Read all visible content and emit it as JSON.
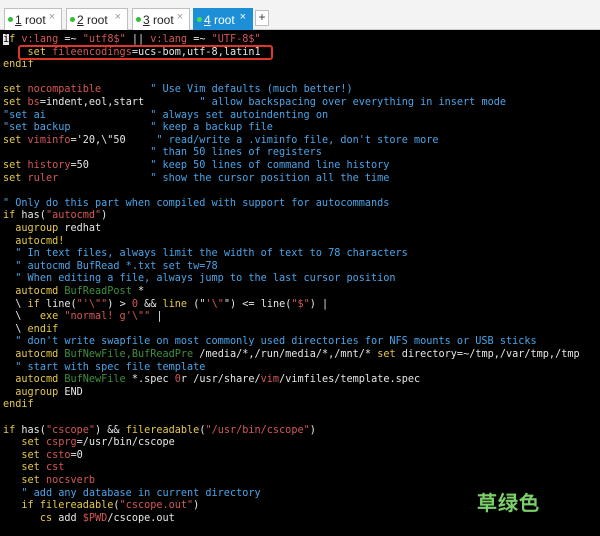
{
  "tabs": [
    {
      "num": "1",
      "label": "root",
      "close": "×"
    },
    {
      "num": "2",
      "label": "root",
      "close": "×"
    },
    {
      "num": "3",
      "label": "root",
      "close": "×"
    },
    {
      "num": "4",
      "label": "root",
      "close": "×"
    }
  ],
  "add_tab": "+",
  "lines": [
    [
      [
        "k",
        "i"
      ],
      [
        "k",
        "f "
      ],
      [
        "o",
        "v:lang"
      ],
      [
        "w",
        " =~ "
      ],
      [
        "o",
        "\"utf8$\""
      ],
      [
        "w",
        " || "
      ],
      [
        "o",
        "v:lang"
      ],
      [
        "w",
        " =~ "
      ],
      [
        "o",
        "\"UTF-8$\""
      ]
    ],
    [
      [
        "w",
        "    "
      ],
      [
        "k",
        "set "
      ],
      [
        "o",
        "fileencodings"
      ],
      [
        "w",
        "=ucs-bom,utf-8,latin1"
      ]
    ],
    [
      [
        "k",
        "endif"
      ]
    ],
    [],
    [
      [
        "k",
        "set "
      ],
      [
        "o",
        "nocompatible"
      ],
      [
        "w",
        "        "
      ],
      [
        "c",
        "\" Use Vim defaults (much better!)"
      ]
    ],
    [
      [
        "k",
        "set "
      ],
      [
        "o",
        "bs"
      ],
      [
        "w",
        "=indent,eol,start"
      ],
      [
        "w",
        "         "
      ],
      [
        "c",
        "\" allow backspacing over everything in insert mode"
      ]
    ],
    [
      [
        "c",
        "\"set ai"
      ],
      [
        "w",
        "                 "
      ],
      [
        "c",
        "\" always set autoindenting on"
      ]
    ],
    [
      [
        "c",
        "\"set backup"
      ],
      [
        "w",
        "             "
      ],
      [
        "c",
        "\" keep a backup file"
      ]
    ],
    [
      [
        "k",
        "set "
      ],
      [
        "o",
        "viminfo"
      ],
      [
        "w",
        "='20,\\\"50"
      ],
      [
        "w",
        "     "
      ],
      [
        "c",
        "\" read/write a .viminfo file, don't store more"
      ]
    ],
    [
      [
        "w",
        "                        "
      ],
      [
        "c",
        "\" than 50 lines of registers"
      ]
    ],
    [
      [
        "k",
        "set "
      ],
      [
        "o",
        "history"
      ],
      [
        "w",
        "=50"
      ],
      [
        "w",
        "          "
      ],
      [
        "c",
        "\" keep 50 lines of command line history"
      ]
    ],
    [
      [
        "k",
        "set "
      ],
      [
        "o",
        "ruler"
      ],
      [
        "w",
        "               "
      ],
      [
        "c",
        "\" show the cursor position all the time"
      ]
    ],
    [],
    [
      [
        "c",
        "\" Only do this part when compiled with support for autocommands"
      ]
    ],
    [
      [
        "k",
        "if "
      ],
      [
        "w",
        "has("
      ],
      [
        "o",
        "\"autocmd\""
      ],
      [
        "w",
        ")"
      ]
    ],
    [
      [
        "w",
        "  "
      ],
      [
        "k",
        "augroup"
      ],
      [
        "w",
        " redhat"
      ]
    ],
    [
      [
        "w",
        "  "
      ],
      [
        "k",
        "autocmd!"
      ]
    ],
    [
      [
        "w",
        "  "
      ],
      [
        "c",
        "\" In text files, always limit the width of text to 78 characters"
      ]
    ],
    [
      [
        "w",
        "  "
      ],
      [
        "c",
        "\" autocmd BufRead *.txt set tw=78"
      ]
    ],
    [
      [
        "w",
        "  "
      ],
      [
        "c",
        "\" When editing a file, always jump to the last cursor position"
      ]
    ],
    [
      [
        "w",
        "  "
      ],
      [
        "k",
        "autocmd "
      ],
      [
        "g",
        "BufReadPost"
      ],
      [
        "w",
        " *"
      ]
    ],
    [
      [
        "w",
        "  \\ "
      ],
      [
        "k",
        "if "
      ],
      [
        "w",
        "line("
      ],
      [
        "o",
        "\"'\\\"\""
      ],
      [
        "w",
        ") > "
      ],
      [
        "o",
        "0"
      ],
      [
        "w",
        " && "
      ],
      [
        "k",
        "line "
      ],
      [
        "w",
        "(\""
      ],
      [
        "o",
        "'\\\""
      ],
      [
        "w",
        "\") <= "
      ],
      [
        "w",
        "line("
      ],
      [
        "o",
        "\"$\""
      ],
      [
        "w",
        ") |"
      ]
    ],
    [
      [
        "w",
        "  \\   "
      ],
      [
        "k",
        "exe "
      ],
      [
        "o",
        "\"normal! g'\\\"\""
      ],
      [
        "w",
        " |"
      ]
    ],
    [
      [
        "w",
        "  \\ "
      ],
      [
        "k",
        "endif"
      ]
    ],
    [
      [
        "w",
        "  "
      ],
      [
        "c",
        "\" don't write swapfile on most commonly used directories for NFS mounts or USB sticks"
      ]
    ],
    [
      [
        "w",
        "  "
      ],
      [
        "k",
        "autocmd "
      ],
      [
        "g",
        "BufNewFile,BufReadPre"
      ],
      [
        "w",
        " /media/*,/run/media/*,/mnt/* "
      ],
      [
        "k",
        "set "
      ],
      [
        "w",
        "directory=~/tmp,/var/tmp,/tmp"
      ]
    ],
    [
      [
        "w",
        "  "
      ],
      [
        "c",
        "\" start with spec file template"
      ]
    ],
    [
      [
        "w",
        "  "
      ],
      [
        "k",
        "autocmd "
      ],
      [
        "g",
        "BufNewFile"
      ],
      [
        "w",
        " *.spec "
      ],
      [
        "o",
        "0"
      ],
      [
        "w",
        "r /usr/share/"
      ],
      [
        "o",
        "vim"
      ],
      [
        "w",
        "/vimfiles/template.spec"
      ]
    ],
    [
      [
        "w",
        "  "
      ],
      [
        "k",
        "augroup"
      ],
      [
        "w",
        " END"
      ]
    ],
    [
      [
        "k",
        "endif"
      ]
    ],
    [],
    [
      [
        "k",
        "if "
      ],
      [
        "w",
        "has("
      ],
      [
        "o",
        "\"cscope\""
      ],
      [
        "w",
        ") && "
      ],
      [
        "k",
        "filereadable"
      ],
      [
        "w",
        "("
      ],
      [
        "o",
        "\"/usr/bin/cscope\""
      ],
      [
        "w",
        ")"
      ]
    ],
    [
      [
        "w",
        "   "
      ],
      [
        "k",
        "set "
      ],
      [
        "o",
        "csprg"
      ],
      [
        "w",
        "=/usr/bin/cscope"
      ]
    ],
    [
      [
        "w",
        "   "
      ],
      [
        "k",
        "set "
      ],
      [
        "o",
        "csto"
      ],
      [
        "w",
        "=0"
      ]
    ],
    [
      [
        "w",
        "   "
      ],
      [
        "k",
        "set "
      ],
      [
        "o",
        "cst"
      ]
    ],
    [
      [
        "w",
        "   "
      ],
      [
        "k",
        "set "
      ],
      [
        "o",
        "nocsverb"
      ]
    ],
    [
      [
        "w",
        "   "
      ],
      [
        "c",
        "\" add any database in current directory"
      ]
    ],
    [
      [
        "w",
        "   "
      ],
      [
        "k",
        "if "
      ],
      [
        "k",
        "filereadable"
      ],
      [
        "w",
        "("
      ],
      [
        "o",
        "\"cscope.out\""
      ],
      [
        "w",
        ")"
      ]
    ],
    [
      [
        "w",
        "      "
      ],
      [
        "k",
        "cs "
      ],
      [
        "w",
        "add "
      ],
      [
        "o",
        "$PWD"
      ],
      [
        "w",
        "/cscope.out"
      ]
    ]
  ],
  "watermark": "草绿色"
}
